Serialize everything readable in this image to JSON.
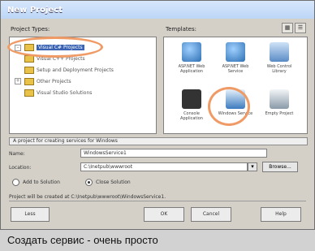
{
  "window": {
    "title": "New Project"
  },
  "left_pane": {
    "label": "Project Types:",
    "items": [
      {
        "label": "Visual C# Projects",
        "selected": true
      },
      {
        "label": "Visual C++ Projects",
        "selected": false
      },
      {
        "label": "Setup and Deployment Projects",
        "selected": false
      },
      {
        "label": "Other Projects",
        "selected": false
      },
      {
        "label": "Visual Studio Solutions",
        "selected": false
      }
    ]
  },
  "right_pane": {
    "label": "Templates:",
    "templates": [
      {
        "label": "ASP.NET Web Application",
        "icon": "web-app-icon",
        "color": "#2d6fb3"
      },
      {
        "label": "ASP.NET Web Service",
        "icon": "web-service-icon",
        "color": "#2d6fb3"
      },
      {
        "label": "Web Control Library",
        "icon": "control-library-icon",
        "color": "#5a8bc6"
      },
      {
        "label": "Console Application",
        "icon": "console-icon",
        "color": "#333333"
      },
      {
        "label": "Windows Service",
        "icon": "windows-service-icon",
        "color": "#3b7bbf"
      },
      {
        "label": "Empty Project",
        "icon": "empty-project-icon",
        "color": "#8a9aa8"
      }
    ]
  },
  "description": "A project for creating services for Windows",
  "form": {
    "name_label": "Name:",
    "name_value": "WindowsService1",
    "location_label": "Location:",
    "location_value": "C:\\Inetpub\\wwwroot",
    "browse_label": "Browse...",
    "add_solution_label": "Add to Solution",
    "close_solution_label": "Close Solution",
    "info": "Project will be created at C:\\Inetpub\\wwwroot\\WindowsService1."
  },
  "buttons": {
    "less": "Less",
    "ok": "OK",
    "cancel": "Cancel",
    "help": "Help"
  },
  "caption": "Создать сервис - очень просто"
}
